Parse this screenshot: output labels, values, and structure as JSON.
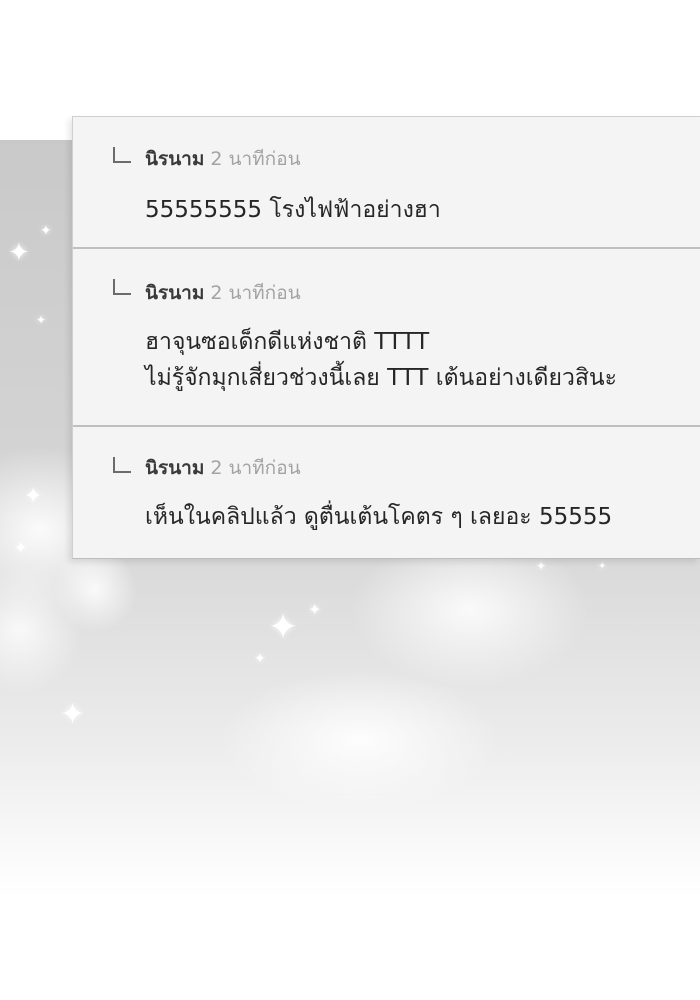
{
  "comments": [
    {
      "author": "นิรนาม",
      "time": "2 นาทีก่อน",
      "lines": [
        "55555555 โรงไฟฟ้าอย่างฮา"
      ]
    },
    {
      "author": "นิรนาม",
      "time": "2 นาทีก่อน",
      "lines": [
        "ฮาจุนซอเด็กดีแห่งชาติ TTTT",
        "ไม่รู้จักมุกเสี่ยวช่วงนี้เลย TTT เต้นอย่างเดียวสินะ"
      ]
    },
    {
      "author": "นิรนาม",
      "time": "2 นาทีก่อน",
      "lines": [
        "เห็นในคลิปแล้ว ดูตื่นเต้นโคตร ๆ เลยอะ 55555"
      ]
    }
  ],
  "icons": {
    "reply": "reply-arrow-icon",
    "sparkle": "sparkle-icon"
  },
  "colors": {
    "panel_background": "#f4f4f4",
    "divider": "#bfbfbf",
    "author_text": "#3a3a3a",
    "time_text": "#a3a3a3",
    "body_text": "#262626"
  }
}
